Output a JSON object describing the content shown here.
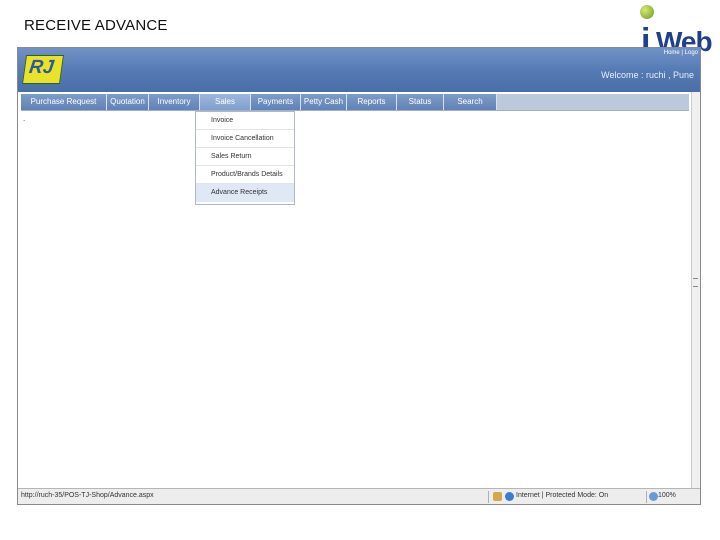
{
  "slide": {
    "title": "RECEIVE ADVANCE"
  },
  "brand": {
    "name_i": "i",
    "name_rest": "Web"
  },
  "app": {
    "logo_text": "RJ",
    "top_links": "Home | Logo",
    "welcome": "Welcome : ruchi , Pune",
    "nav": [
      {
        "label": "Purchase Request"
      },
      {
        "label": "Quotation"
      },
      {
        "label": "Inventory"
      },
      {
        "label": "Sales"
      },
      {
        "label": "Payments"
      },
      {
        "label": "Petty Cash"
      },
      {
        "label": "Reports"
      },
      {
        "label": "Status"
      },
      {
        "label": "Search"
      }
    ],
    "sales_menu": [
      {
        "label": "Invoice"
      },
      {
        "label": "Invoice Cancellation"
      },
      {
        "label": "Sales Return"
      },
      {
        "label": "Product/Brands Details"
      },
      {
        "label": "Advance Receipts"
      }
    ],
    "content_marker": "."
  },
  "statusbar": {
    "url": "http://ruch-35/POS-TJ-Shop/Advance.aspx",
    "zone": "Internet | Protected Mode: On",
    "zoom": "100%"
  }
}
